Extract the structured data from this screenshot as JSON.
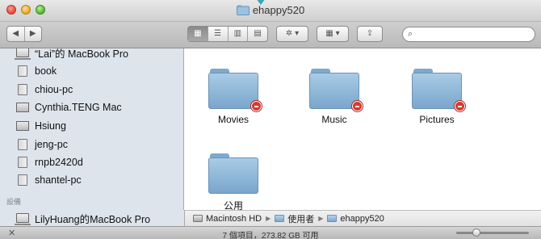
{
  "window": {
    "title": "ehappy520"
  },
  "toolbar": {
    "back_label": "◀",
    "forward_label": "▶",
    "views": [
      "▦",
      "☰",
      "▥",
      "▤"
    ],
    "action_label": "✲ ▾",
    "arrange_label": "▦ ▾",
    "share_label": "⇪"
  },
  "search": {
    "placeholder": ""
  },
  "sidebar": {
    "items": [
      {
        "label": "“Lai”的 MacBook Pro",
        "icon": "laptop-icon"
      },
      {
        "label": "book",
        "icon": "tower-icon"
      },
      {
        "label": "chiou-pc",
        "icon": "tower-icon"
      },
      {
        "label": "Cynthia.TENG Mac",
        "icon": "display-icon"
      },
      {
        "label": "Hsiung",
        "icon": "display-icon"
      },
      {
        "label": "jeng-pc",
        "icon": "tower-icon"
      },
      {
        "label": "rnpb2420d",
        "icon": "tower-icon"
      },
      {
        "label": "shantel-pc",
        "icon": "tower-icon"
      }
    ],
    "section_header": "設備",
    "devices": [
      {
        "label": "LilyHuang的MacBook Pro",
        "icon": "laptop-icon"
      }
    ]
  },
  "folders": [
    {
      "label": "Movies",
      "restricted": true
    },
    {
      "label": "Music",
      "restricted": true
    },
    {
      "label": "Pictures",
      "restricted": true
    },
    {
      "label": "公用",
      "restricted": false
    }
  ],
  "path": [
    "Macintosh HD",
    "使用者",
    "ehappy520"
  ],
  "status": {
    "text": "7 個項目，273.82 GB 可用"
  },
  "colors": {
    "sidebar_bg": "#dde4ec",
    "folder_blue": "#7aa6cb",
    "badge_red": "#d83a2e"
  }
}
